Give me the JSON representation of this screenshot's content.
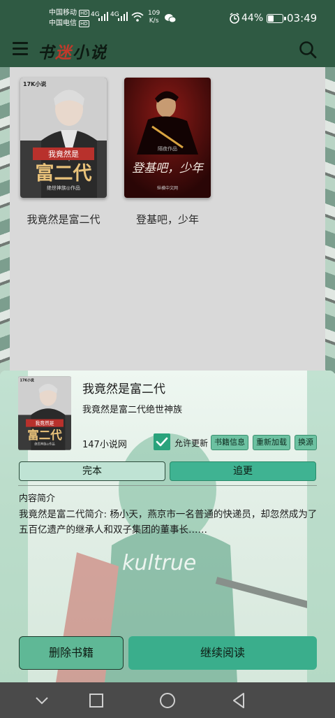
{
  "status_bar": {
    "carrier1": "中国移动",
    "carrier2": "中国电信",
    "hd_badge": "HD",
    "signal1_type": "4G",
    "signal2_type": "4G",
    "net_speed": "109",
    "net_unit": "K/s",
    "battery_pct": "44%",
    "battery_level": 0.44,
    "time": "03:49"
  },
  "app_bar": {
    "logo_part1": "书",
    "logo_part2": "迷",
    "logo_part3": "小说"
  },
  "shelf": {
    "books": [
      {
        "title": "我竟然是富二代",
        "cover_badge": "我竟然是",
        "cover_big": "富二代",
        "cover_author": "绝世神族◎作品",
        "cover_logo": "17K小说"
      },
      {
        "title": "登基吧，少年",
        "cover_big": "登基吧，少年",
        "cover_author": "隔夜作品",
        "cover_logo": "纵横中文网"
      }
    ]
  },
  "sheet": {
    "title": "我竟然是富二代",
    "author": "我竟然是富二代绝世神族",
    "source": "147小说网",
    "allow_update_label": "允许更新",
    "allow_update_checked": true,
    "chips": [
      "书籍信息",
      "重新加载",
      "换源"
    ],
    "status_done": "完本",
    "status_follow": "追更",
    "intro_label": "内容简介",
    "intro_text": "我竟然是富二代简介: 杨小天，燕京市一名普通的快递员，却忽然成为了五百亿遗产的继承人和双子集团的董事长……",
    "art_text": "kultrue",
    "delete_label": "删除书籍",
    "read_label": "继续阅读"
  },
  "colors": {
    "app_bar": "#2f5a43",
    "accent": "#3aae8c",
    "chip": "#6cc1a1"
  }
}
